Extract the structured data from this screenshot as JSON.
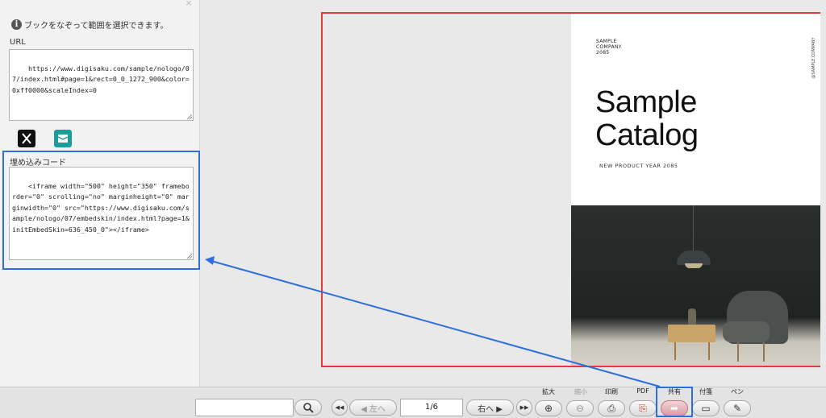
{
  "panel": {
    "info_text": "ブックをなぞって範囲を選択できます。",
    "url_label": "URL",
    "url_value": "https://www.digisaku.com/sample/nologo/07/index.html#page=1&rect=0_0_1272_900&color=0xff0000&scaleIndex=0",
    "embed_label": "埋め込みコード",
    "embed_code": "<iframe width=\"500\" height=\"350\" frameborder=\"0\" scrolling=\"no\" marginheight=\"0\" marginwidth=\"0\" src=\"https://www.digisaku.com/sample/nologo/07/embedskin/index.html?page=1&initEmbedSkin=636_450_0\"></iframe>",
    "close_glyph": "×",
    "x_glyph": "𝕏",
    "mail_glyph": "✉"
  },
  "book": {
    "company_lines": [
      "SAMPLE",
      "COMPANY",
      "2085"
    ],
    "vertical_text": "@SAMPLE COMPANY",
    "title_lines": [
      "Sample",
      "Catalog"
    ],
    "subtitle": "NEW PRODUCT YEAR 2085"
  },
  "toolbar": {
    "search_value": "",
    "search_glyph": "🔍",
    "first_glyph": "◀◀",
    "prev_label": "◀ 左へ",
    "page_indicator": "1/6",
    "next_label": "右へ ▶",
    "last_glyph": "▶▶",
    "tools": [
      {
        "label": "拡大",
        "glyph": "⊕"
      },
      {
        "label": "縮小",
        "glyph": "⊖"
      },
      {
        "label": "印刷",
        "glyph": "⎙"
      },
      {
        "label": "PDF",
        "glyph": "⎘"
      },
      {
        "label": "共有",
        "glyph": "➦"
      },
      {
        "label": "付箋",
        "glyph": "▭"
      },
      {
        "label": "ペン",
        "glyph": "✎"
      }
    ]
  },
  "colors": {
    "highlight_blue": "#2e6fdb",
    "highlight_red": "#e23a3a",
    "mail_green": "#1c9d9a"
  }
}
